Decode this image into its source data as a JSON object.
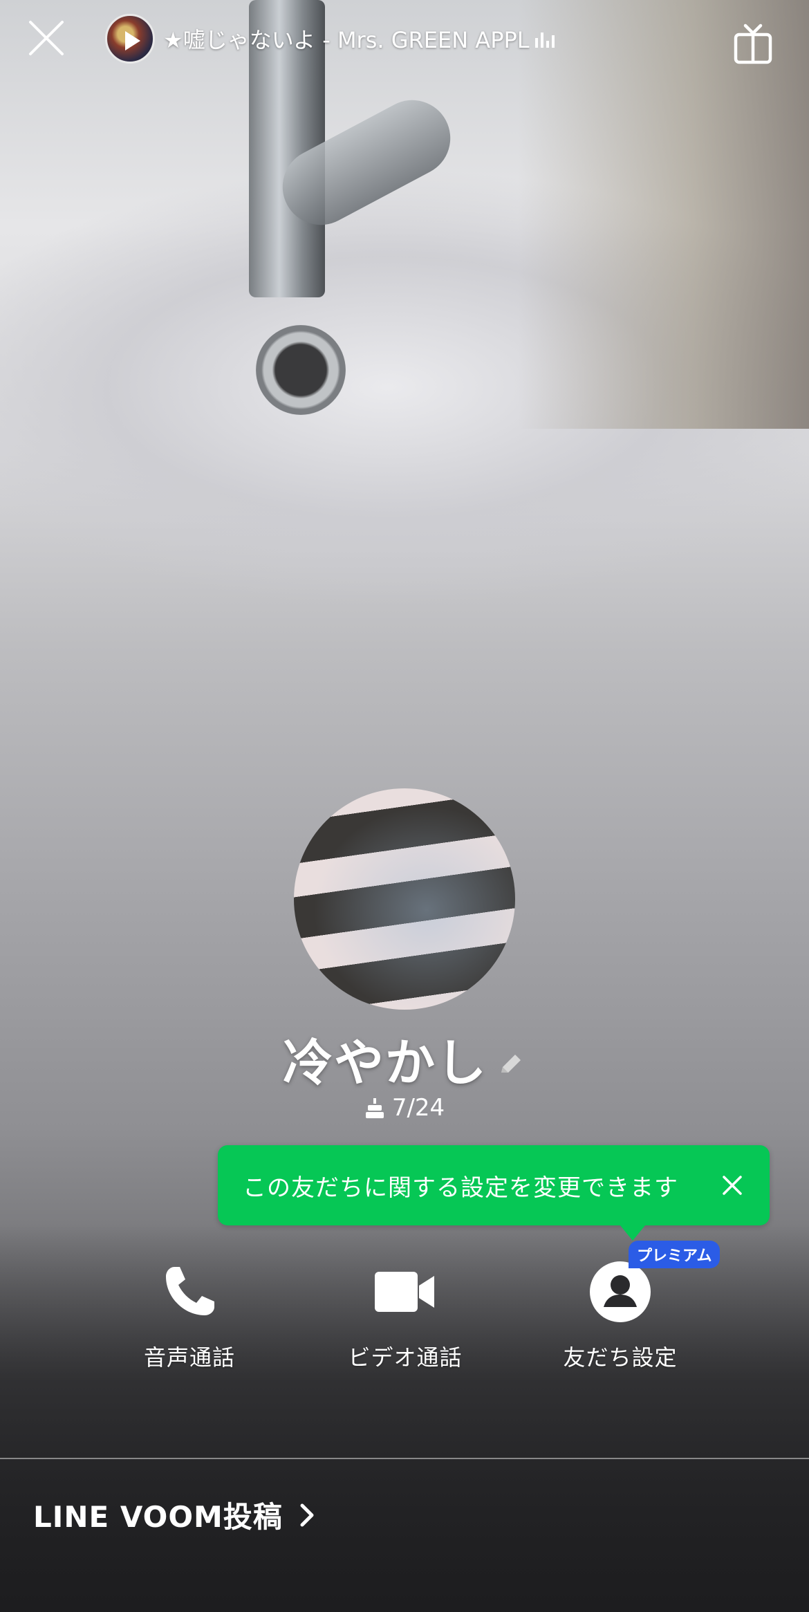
{
  "top_bar": {
    "music_title": "★嘘じゃないよ - Mrs. GREEN APPL"
  },
  "profile": {
    "name": "冷やかし",
    "birthday": "7/24"
  },
  "tooltip": {
    "text": "この友だちに関する設定を変更できます"
  },
  "actions": [
    {
      "label": "音声通話",
      "icon": "phone-icon"
    },
    {
      "label": "ビデオ通話",
      "icon": "video-camera-icon"
    },
    {
      "label": "友だち設定",
      "icon": "person-icon",
      "badge": "プレミアム"
    }
  ],
  "footer": {
    "voom_label": "LINE VOOM投稿"
  },
  "colors": {
    "tooltip_green": "#06c755",
    "premium_blue": "#2b5ce6"
  }
}
